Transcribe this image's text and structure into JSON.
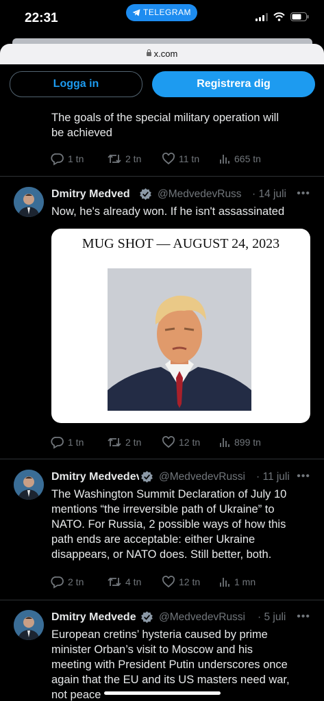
{
  "status_bar": {
    "time": "22:31",
    "back_app": "TELEGRAM"
  },
  "browser": {
    "url": "x.com"
  },
  "auth": {
    "login_label": "Logga in",
    "register_label": "Registrera dig"
  },
  "tweets": [
    {
      "text_lines": [
        "The goals of the special military operation will",
        "be achieved"
      ],
      "stats": {
        "replies": "1 tn",
        "reposts": "2 tn",
        "likes": "11 tn",
        "views": "665 tn"
      }
    },
    {
      "author": "Dmitry Medved",
      "handle": "@MedvedevRuss",
      "date": "· 14 juli",
      "text_lines": [
        "Now, he's already won. If he isn't assassinated"
      ],
      "media_caption": "MUG SHOT — AUGUST 24, 2023",
      "stats": {
        "replies": "1 tn",
        "reposts": "2 tn",
        "likes": "12 tn",
        "views": "899 tn"
      }
    },
    {
      "author": "Dmitry Medvedev",
      "handle": "@MedvedevRussi",
      "date": "· 11 juli",
      "text_lines": [
        "The Washington Summit Declaration of July 10",
        "mentions “the irreversible path of Ukraine” to",
        "NATO. For Russia, 2 possible ways of how this",
        "path ends are acceptable: either Ukraine",
        "disappears, or NATO does. Still better, both."
      ],
      "stats": {
        "replies": "2 tn",
        "reposts": "4 tn",
        "likes": "12 tn",
        "views": "1 mn"
      }
    },
    {
      "author": "Dmitry Medvede",
      "handle": "@MedvedevRussi",
      "date": "· 5 juli",
      "text_lines": [
        "European cretins’ hysteria caused by prime",
        "minister Orban’s visit to Moscow and his",
        "meeting with President Putin underscores once",
        "again that the EU and its US masters need war,",
        "not peace"
      ]
    }
  ],
  "colors": {
    "accent": "#1d9bf0",
    "background": "#000000",
    "muted": "#71767b",
    "divider": "#2f3336"
  }
}
